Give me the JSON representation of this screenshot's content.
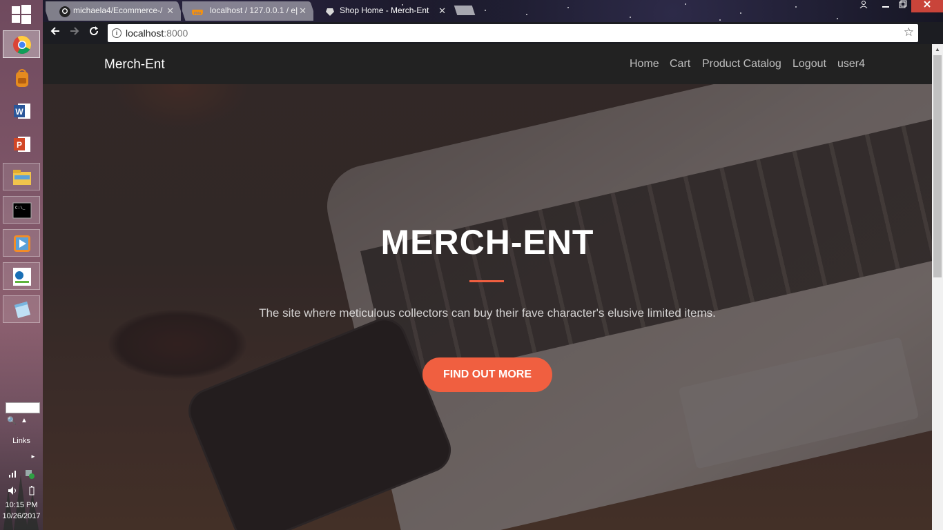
{
  "taskbar": {
    "items": [
      {
        "icon": "chrome-icon",
        "active": true
      },
      {
        "icon": "backpack-icon"
      },
      {
        "icon": "word-icon"
      },
      {
        "icon": "powerpoint-icon"
      },
      {
        "icon": "file-explorer-icon"
      },
      {
        "icon": "command-prompt-icon"
      },
      {
        "icon": "media-player-icon"
      },
      {
        "icon": "globe-broadband-icon"
      },
      {
        "icon": "notepad-icon"
      }
    ],
    "links_label": "Links",
    "clock_time": "10:15 PM",
    "clock_date": "10/26/2017"
  },
  "browser": {
    "tabs": [
      {
        "label": "michaela4/Ecommerce-/",
        "favicon": "github-icon",
        "active": false
      },
      {
        "label": "localhost / 127.0.0.1 / e|",
        "favicon": "phpmyadmin-icon",
        "active": false
      },
      {
        "label": "Shop Home - Merch-Ent",
        "favicon": "shop-icon",
        "active": true
      }
    ],
    "close_glyph": "✕",
    "url_host": "localhost",
    "url_port": ":8000"
  },
  "site": {
    "brand": "Merch-Ent",
    "nav": [
      "Home",
      "Cart",
      "Product Catalog",
      "Logout",
      "user4"
    ],
    "hero_title": "MERCH-ENT",
    "hero_subtitle": "The site where meticulous collectors can buy their fave character's elusive limited items.",
    "cta_label": "FIND OUT MORE",
    "accent_color": "#f05f40"
  }
}
